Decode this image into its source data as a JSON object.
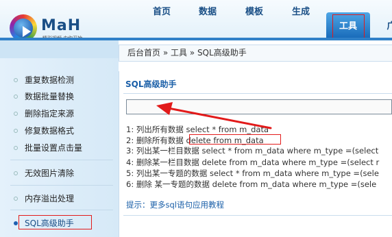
{
  "logo": {
    "text": "MaH",
    "tagline": "精彩视频 由你开始"
  },
  "nav": {
    "items": [
      {
        "label": "首页"
      },
      {
        "label": "数据"
      },
      {
        "label": "模板"
      },
      {
        "label": "生成"
      },
      {
        "label": "工具"
      },
      {
        "label": "广"
      }
    ],
    "active_index": 4
  },
  "breadcrumb": "后台首页 » 工具 » SQL高级助手",
  "sidebar": {
    "items": [
      {
        "label": "重复数据检测"
      },
      {
        "label": "数据批量替换"
      },
      {
        "label": "删除指定来源"
      },
      {
        "label": "修复数据格式"
      },
      {
        "label": "批量设置点击量"
      },
      {
        "label": "无效图片清除"
      },
      {
        "label": "内存溢出处理"
      },
      {
        "label": "SQL高级助手"
      }
    ]
  },
  "panel": {
    "title": "SQL高级助手",
    "input_value": "",
    "examples": [
      "1: 列出所有数据 select * from m_data",
      "2: 删除所有数据 delete from m_data",
      "3: 列出某一栏目数据 select * from m_data where m_type =(select",
      "4: 删除某一栏目数据 delete from m_data where m_type =(select r",
      "5: 列出某一专题的数据 select * from m_data where m_type =(sele",
      "6: 删除 某一专题的数据 delete from m_data where m_type =(sele"
    ],
    "tip": "提示：更多sql语句应用教程"
  },
  "colors": {
    "accent": "#1769b8",
    "annotation": "#e21a1a",
    "nav_text": "#1a4f86"
  }
}
